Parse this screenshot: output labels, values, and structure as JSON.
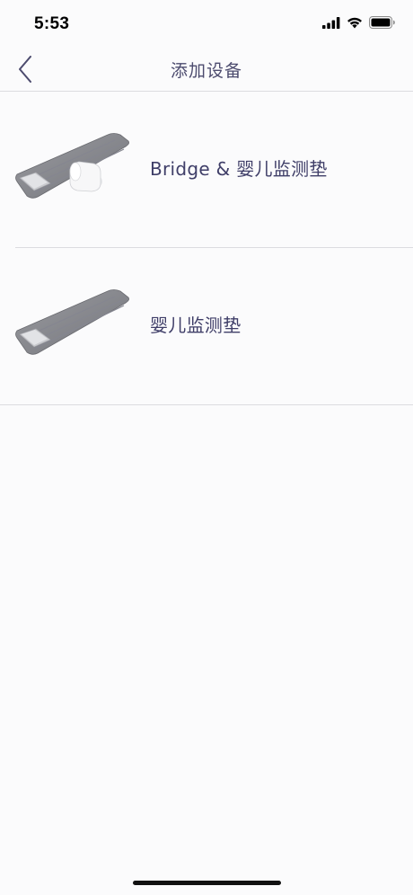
{
  "status_bar": {
    "time": "5:53",
    "icons": [
      "cellular-signal-icon",
      "wifi-icon",
      "battery-icon"
    ]
  },
  "nav": {
    "title": "添加设备",
    "back_icon": "chevron-left-icon"
  },
  "devices": [
    {
      "label": "Bridge & 婴儿监测垫",
      "image": "mat-with-bridge-image"
    },
    {
      "label": "婴儿监测垫",
      "image": "mat-image"
    }
  ],
  "colors": {
    "accent": "#4c4b6e",
    "label": "#3f3e68",
    "divider": "#dcdce0",
    "background": "#fbfbfc"
  }
}
